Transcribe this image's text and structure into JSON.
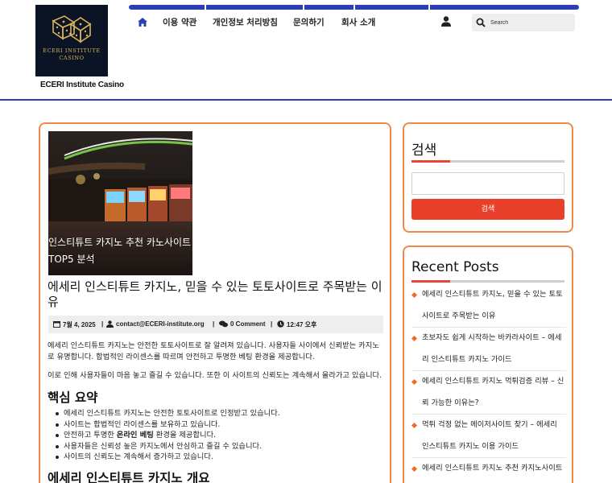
{
  "site": {
    "logo_line1": "ECERI INSTITUTE",
    "logo_line2": "CASINO",
    "title": "ECERI Institute Casino"
  },
  "nav": {
    "home_icon": "home-icon",
    "items": [
      "이용 약관",
      "개인정보 처리방침",
      "문의하기",
      "회사 소개"
    ],
    "user_icon": "user-icon",
    "search_placeholder": "Search"
  },
  "article": {
    "thumb_caption": "인스티튜트 카지노 추천 카노사이트 TOP5 분석",
    "title": "에세리 인스티튜트 카지노, 믿을 수 있는 토토사이트로 주목받는 이유",
    "meta": {
      "date": "7월 4, 2025",
      "author": "contact@ECERI-institute.org",
      "comments": "0 Comment",
      "time": "12:47 오후"
    },
    "para1": "에세리 인스티튜트 카지노는 안전한 토토사이트로 잘 알려져 있습니다. 사용자들 사이에서 신뢰받는 카지노로 유명합니다. 합법적인 라이센스를 따르며 안전하고 투명한 베팅 환경을 제공합니다.",
    "para2": "이로 인해 사용자들이 마음 놓고 즐길 수 있습니다. 또한 이 사이트의 신뢰도는 계속해서 올라가고 있습니다.",
    "summary_heading": "핵심 요약",
    "bullets": [
      "에세리 인스티튜트 카지노는 안전한 토토사이트로 인정받고 있습니다.",
      "사이트는 합법적인 라이센스를 보유하고 있습니다.",
      "안전하고 투명한 온라인 베팅 환경을 제공합니다.",
      "사용자들은 신뢰성 높은 카지노에서 안심하고 즐길 수 있습니다.",
      "사이트의 신뢰도는 계속해서 증가하고 있습니다."
    ],
    "bullet3_pre": "안전하고 투명한 ",
    "bullet3_bold": "온라인 베팅",
    "bullet3_post": " 환경을 제공합니다.",
    "overview_heading": "에세리 인스티튜트 카지노 개요"
  },
  "sidebar": {
    "search_title": "검색",
    "search_button": "검색",
    "recent_title": "Recent Posts",
    "recent_posts": [
      "에세리 인스티튜트 카지노, 믿을 수 있는 토토사이트로 주목받는 이유",
      "초보자도 쉽게 시작하는 바카라사이트 – 에세리 인스티튜트 카지노 가이드",
      "에세리 인스티튜트 카지노 먹튀검증 리뷰 – 신뢰 가능한 이유는?",
      "먹튀 걱정 없는 메이저사이트 찾기 – 에세리 인스티튜트 카지노 이용 가이드",
      "에세리 인스티튜트 카지노 추천 카지노사이트"
    ]
  },
  "colors": {
    "nav_blue": "#2b3fb3",
    "card_border": "#ef8a4a",
    "button_red": "#e8402a"
  }
}
